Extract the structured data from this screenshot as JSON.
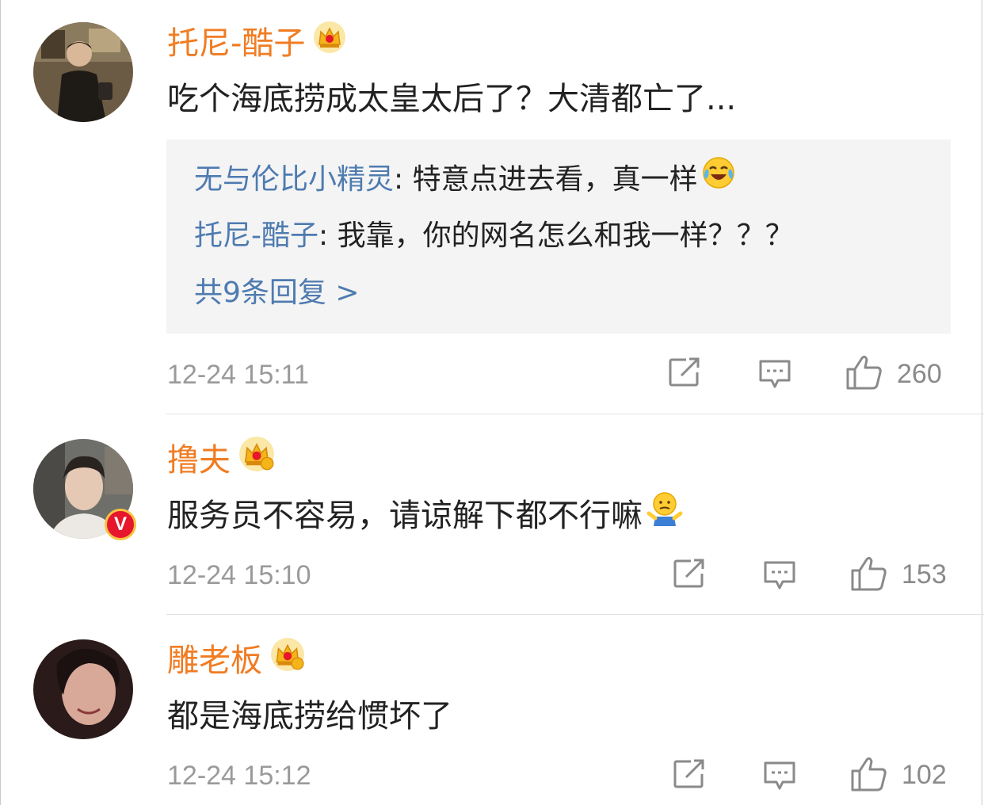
{
  "comments": [
    {
      "username": "托尼-酷子",
      "text": "吃个海底捞成太皇太后了？大清都亡了...",
      "replies": [
        {
          "name": "无与伦比小精灵",
          "separator": ": ",
          "text": "特意点进去看，真一样"
        },
        {
          "name": "托尼-酷子",
          "separator": ": ",
          "text": "我靠，你的网名怎么和我一样？？？"
        }
      ],
      "more_replies": "共9条回复 >",
      "time": "12-24 15:11",
      "likes": "260"
    },
    {
      "username": "撸夫",
      "text": "服务员不容易，请谅解下都不行嘛",
      "time": "12-24 15:10",
      "likes": "153"
    },
    {
      "username": "雕老板",
      "text": "都是海底捞给惯坏了",
      "time": "12-24 15:12",
      "likes": "102"
    }
  ],
  "badges": {
    "verified": "V"
  },
  "icons": {
    "vip": "crown-icon",
    "share": "share-icon",
    "comment": "comment-icon",
    "like": "thumbs-up-icon",
    "laugh_cry": "laugh-cry-emoji",
    "shrug": "shrug-emoji"
  },
  "colors": {
    "username": "#f07c23",
    "reply_name": "#4e7bb0",
    "meta": "#9a9a9a",
    "reply_bg": "#f4f4f4",
    "badge_red": "#e6162d"
  }
}
